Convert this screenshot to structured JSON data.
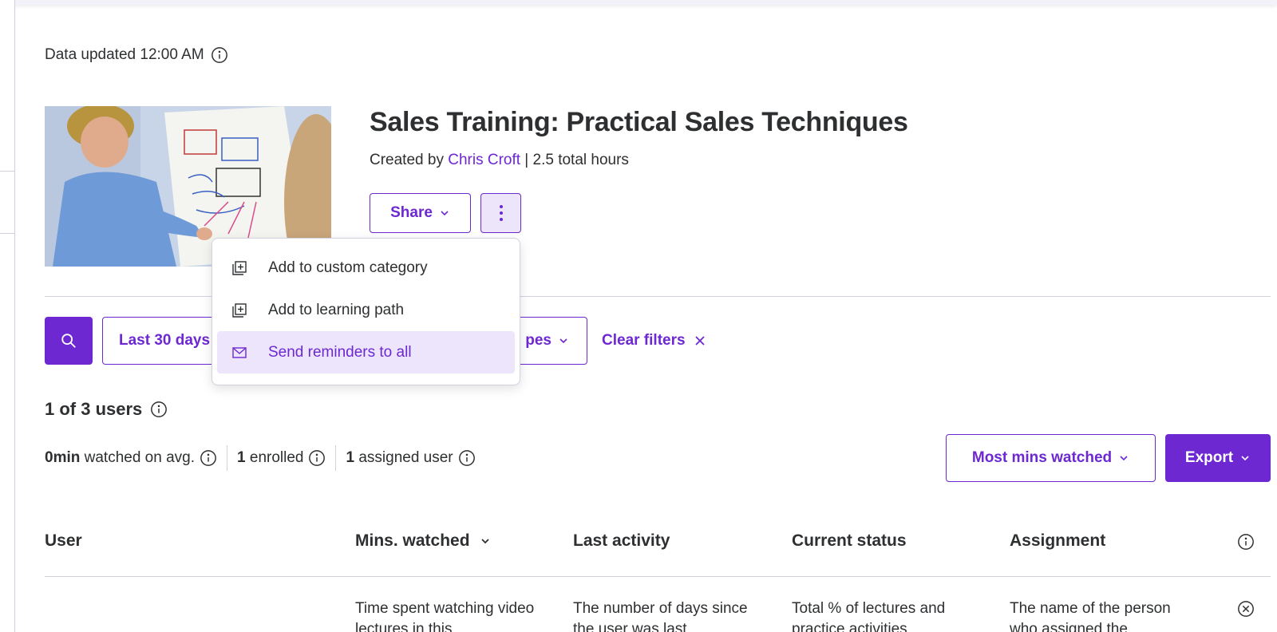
{
  "header": {
    "data_updated": "Data updated 12:00 AM"
  },
  "course": {
    "title": "Sales Training: Practical Sales Techniques",
    "created_by_prefix": "Created by ",
    "author": "Chris Croft",
    "hours": " | 2.5 total hours",
    "share_label": "Share"
  },
  "menu": {
    "items": [
      {
        "label": "Add to custom category",
        "icon": "add-category-icon"
      },
      {
        "label": "Add to learning path",
        "icon": "add-path-icon"
      },
      {
        "label": "Send reminders to all",
        "icon": "mail-icon",
        "active": true
      }
    ]
  },
  "filters": {
    "date_label": "Last 30 days",
    "types_label": "pes",
    "clear_label": "Clear filters"
  },
  "summary": {
    "users_count": "1 of 3 users",
    "watched_value": "0min",
    "watched_label": " watched on avg.",
    "enrolled_value": "1",
    "enrolled_label": " enrolled",
    "assigned_value": "1",
    "assigned_label": " assigned user"
  },
  "actions": {
    "sort_label": "Most mins watched",
    "export_label": "Export"
  },
  "table": {
    "headers": [
      "User",
      "Mins. watched",
      "Last activity",
      "Current status",
      "Assignment"
    ],
    "descriptions": [
      "Time spent watching video lectures in this",
      "The number of days since the user was last",
      "Total % of lectures and practice activities",
      "The name of the person who assigned the"
    ]
  },
  "colors": {
    "accent": "#6d28d2",
    "accent_light": "#ece5fb",
    "text": "#2d2f31",
    "border": "#d1d2e0"
  }
}
